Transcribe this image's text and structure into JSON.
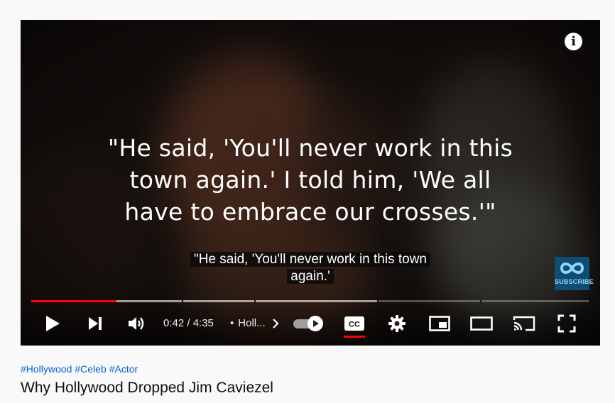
{
  "player": {
    "overlay_quote": [
      "\"He said, 'You'll never work in this",
      "town again.' I told him, 'We all",
      "have to embrace our crosses.'\""
    ],
    "captions": [
      "\"He said, 'You'll never work in this town",
      "again.'"
    ],
    "info_icon": "info-icon",
    "subscribe_badge": {
      "label": "SUBSCRIBE",
      "icon": "infinity-icon",
      "color": "#0f4d73"
    },
    "progress": {
      "played_fraction": 0.153,
      "buffered_fraction": 0.62,
      "chapter_gaps": [
        0.27,
        0.4,
        0.62,
        0.805
      ],
      "played_color": "#ff0000"
    },
    "controls": {
      "time": "0:42 / 4:35",
      "chapter": "Holl...",
      "autoplay_on": true,
      "captions_on": true,
      "icons": [
        "play-icon",
        "next-icon",
        "volume-icon",
        "chevron-right-icon",
        "autoplay-toggle",
        "captions-icon",
        "settings-icon",
        "miniplayer-icon",
        "theater-icon",
        "cast-icon",
        "fullscreen-icon"
      ]
    }
  },
  "video": {
    "hashtags": [
      "#Hollywood",
      "#Celeb",
      "#Actor"
    ],
    "title": "Why Hollywood Dropped Jim Caviezel"
  }
}
